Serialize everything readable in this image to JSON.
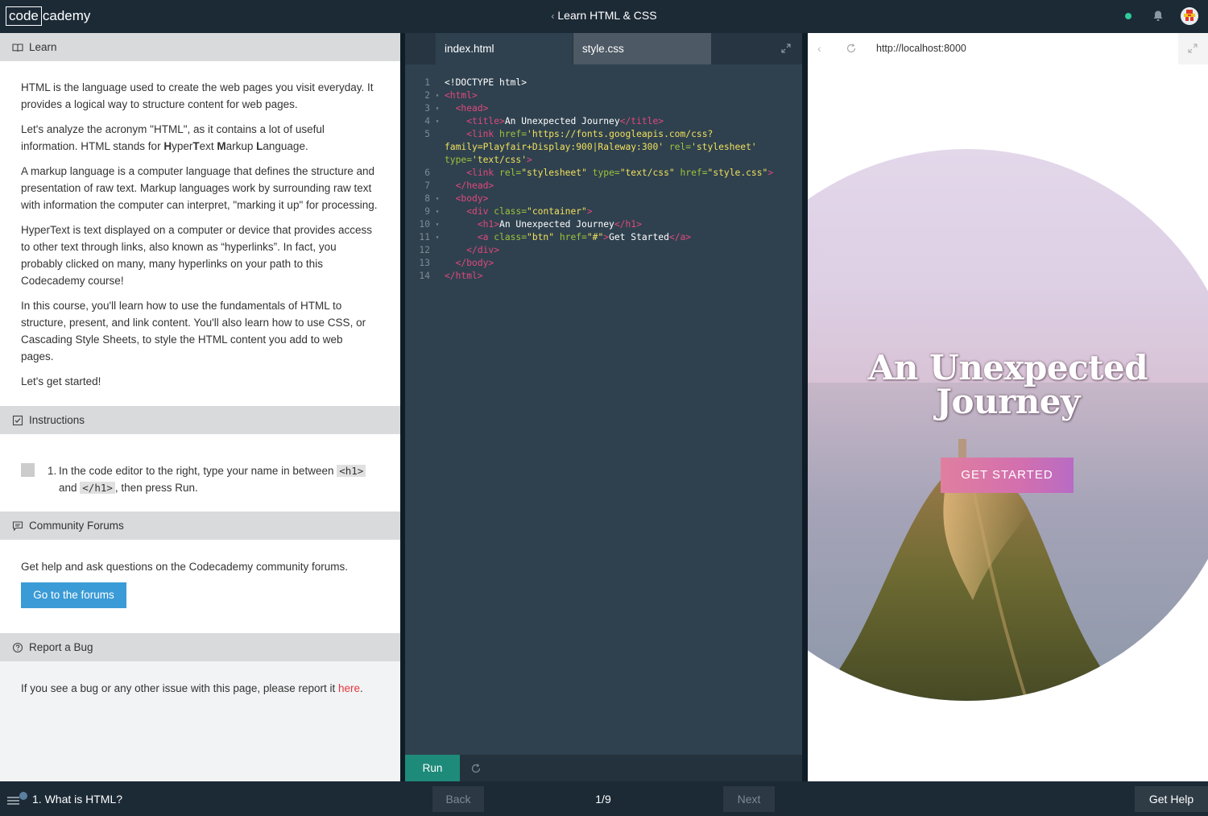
{
  "topbar": {
    "logo_box": "code",
    "logo_rest": "cademy",
    "title": "Learn HTML & CSS",
    "status_color": "#2ecc9b"
  },
  "learn": {
    "header": "Learn",
    "p1": "HTML is the language used to create the web pages you visit everyday. It provides a logical way to structure content for web pages.",
    "p2_a": "Let's analyze the acronym \"HTML\", as it contains a lot of useful information. HTML stands for ",
    "p2_h": "H",
    "p2_yper": "yper",
    "p2_t": "T",
    "p2_ext": "ext ",
    "p2_m": "M",
    "p2_arkup": "arkup ",
    "p2_l": "L",
    "p2_anguage": "anguage.",
    "p3": "A markup language is a computer language that defines the structure and presentation of raw text. Markup languages work by surrounding raw text with information the computer can interpret, \"marking it up\" for processing.",
    "p4": "HyperText is text displayed on a computer or device that provides access to other text through links, also known as “hyperlinks”. In fact, you probably clicked on many, many hyperlinks on your path to this Codecademy course!",
    "p5": "In this course, you'll learn how to use the fundamentals of HTML to structure, present, and link content. You'll also learn how to use CSS, or Cascading Style Sheets, to style the HTML content you add to web pages.",
    "p6": "Let's get started!"
  },
  "instructions": {
    "header": "Instructions",
    "num": "1.",
    "text_a": "In the code editor to the right, type your name in between ",
    "code_open": "<h1>",
    "text_b": " and ",
    "code_close": "</h1>",
    "text_c": ", then press Run."
  },
  "forums": {
    "header": "Community Forums",
    "text": "Get help and ask questions on the Codecademy community forums.",
    "button": "Go to the forums"
  },
  "bug": {
    "header": "Report a Bug",
    "text": "If you see a bug or any other issue with this page, please report it ",
    "link": "here",
    "end": "."
  },
  "editor": {
    "tab1": "index.html",
    "tab2": "style.css",
    "run": "Run",
    "code": {
      "l1": "<!DOCTYPE html>",
      "l2": "<html>",
      "l3": "<head>",
      "l4_open": "<title>",
      "l4_text": "An Unexpected Journey",
      "l4_close": "</title>",
      "l5_tag": "<link ",
      "l5_href": "href=",
      "l5_hrefval": "'https://fonts.googleapis.com/css?family=Playfair+Display:900|Raleway:300'",
      "l5_rel": " rel=",
      "l5_relval": "'stylesheet'",
      "l5_type": " type=",
      "l5_typeval": "'text/css'",
      "l5_end": ">",
      "l6_tag": "<link ",
      "l6_rel": "rel=",
      "l6_relval": "\"stylesheet\"",
      "l6_type": " type=",
      "l6_typeval": "\"text/css\"",
      "l6_href": " href=",
      "l6_hrefval": "\"style.css\"",
      "l6_end": ">",
      "l7": "</head>",
      "l8": "<body>",
      "l9_tag": "<div ",
      "l9_class": "class=",
      "l9_classval": "\"container\"",
      "l9_end": ">",
      "l10_open": "<h1>",
      "l10_text": "An Unexpected Journey",
      "l10_close": "</h1>",
      "l11_tag": "<a ",
      "l11_class": "class=",
      "l11_classval": "\"btn\"",
      "l11_href": " href=",
      "l11_hrefval": "\"#\"",
      "l11_end": ">",
      "l11_text": "Get Started",
      "l11_close": "</a>",
      "l12": "</div>",
      "l13": "</body>",
      "l14": "</html>"
    },
    "line_numbers": [
      "1",
      "2",
      "3",
      "4",
      "5",
      "6",
      "7",
      "8",
      "9",
      "10",
      "11",
      "12",
      "13",
      "14"
    ],
    "colors": {
      "tag": "#e1487d",
      "attr": "#9fc33a",
      "string": "#f1e05a"
    }
  },
  "browser": {
    "url": "http://localhost:8000",
    "hero_title": "An Unexpected Journey",
    "hero_button": "GET STARTED"
  },
  "bottombar": {
    "lesson": "1. What is HTML?",
    "back": "Back",
    "pager": "1/9",
    "next": "Next",
    "help": "Get Help"
  }
}
